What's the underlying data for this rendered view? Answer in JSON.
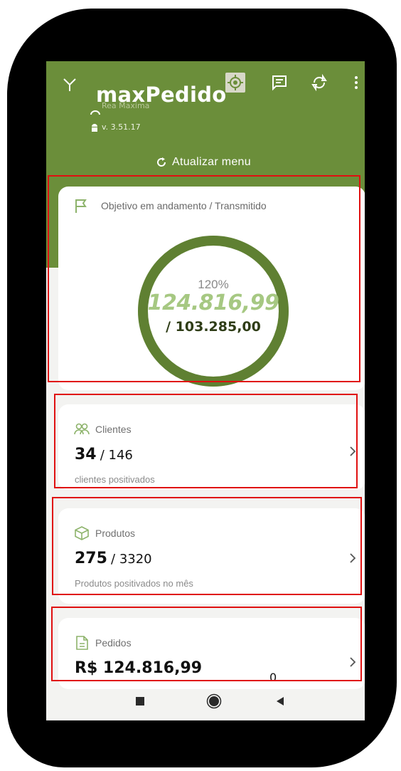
{
  "app": {
    "title": "maxPedido",
    "user_name": "Rea Maxima",
    "version": "v. 3.51.17",
    "update_menu_label": "Atualizar menu"
  },
  "goal": {
    "title": "Objetivo em andamento / Transmitido",
    "percent_label": "120%",
    "achieved_value": "124.816,99",
    "target_value": "/ 103.285,00",
    "progress": 1.0
  },
  "clients": {
    "title": "Clientes",
    "count": "34",
    "total": "/ 146",
    "subtitle": "clientes positivados"
  },
  "products": {
    "title": "Produtos",
    "count": "275",
    "total": "/ 3320",
    "subtitle": "Produtos positivados no mês"
  },
  "orders": {
    "title": "Pedidos",
    "value": "R$ 124.816,99",
    "count": "0"
  },
  "colors": {
    "header_green": "#6b8e3a",
    "ring_green": "#5f8032",
    "value_green": "#a6c882",
    "highlight_red": "#e01010"
  },
  "icons": [
    "signal-icon",
    "gps-icon",
    "message-icon",
    "sync-icon",
    "more-vert-icon",
    "flag-icon",
    "clients-icon",
    "box-icon",
    "document-icon",
    "chevron-right-icon"
  ]
}
